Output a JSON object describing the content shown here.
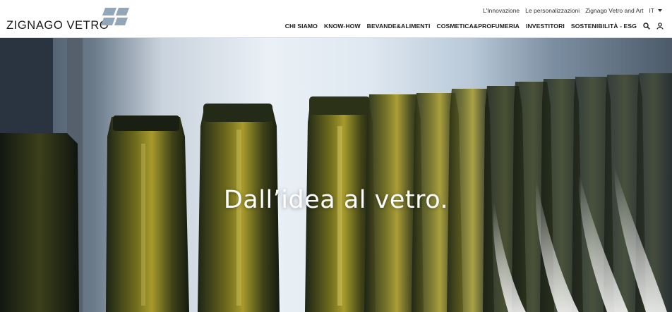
{
  "brand": {
    "name": "ZIGNAGO VETRO",
    "logo_icon": "zignago-mark-icon",
    "mark_color": "#8fa4b8"
  },
  "top_links": {
    "innovation": "L'Innovazione",
    "customization": "Le personalizzazioni",
    "art": "Zignago Vetro and Art",
    "language": "IT"
  },
  "nav": {
    "items": [
      "CHI SIAMO",
      "KNOW-HOW",
      "BEVANDE&ALIMENTI",
      "COSMETICA&PROFUMERIA",
      "INVESTITORI",
      "SOSTENIBILITÀ - ESG"
    ],
    "search_icon": "search-icon",
    "user_icon": "user-icon"
  },
  "hero": {
    "title": "Dall’idea al vetro.",
    "image": "glass bottles on production line"
  }
}
